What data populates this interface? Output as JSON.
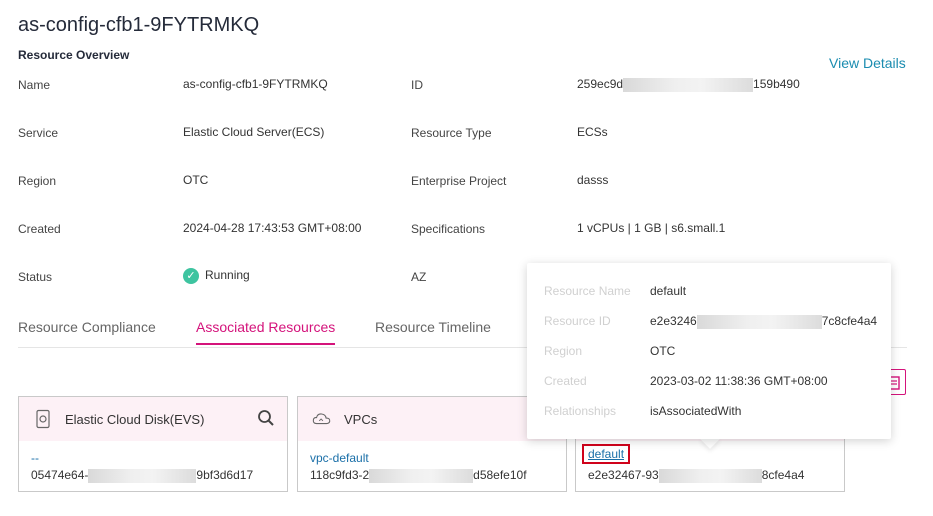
{
  "page": {
    "title": "as-config-cfb1-9FYTRMKQ",
    "section_title": "Resource Overview",
    "view_details": "View Details"
  },
  "overview": {
    "name_label": "Name",
    "name_value": "as-config-cfb1-9FYTRMKQ",
    "service_label": "Service",
    "service_value": "Elastic Cloud Server(ECS)",
    "region_label": "Region",
    "region_value": "OTC",
    "created_label": "Created",
    "created_value": "2024-04-28 17:43:53 GMT+08:00",
    "status_label": "Status",
    "status_value": "Running",
    "id_label": "ID",
    "id_prefix": "259ec9d",
    "id_suffix": "159b490",
    "type_label": "Resource Type",
    "type_value": "ECSs",
    "project_label": "Enterprise Project",
    "project_value": "dasss",
    "spec_label": "Specifications",
    "spec_value": "1 vCPUs | 1 GB | s6.small.1",
    "az_label": "AZ"
  },
  "tabs": {
    "compliance": "Resource Compliance",
    "associated": "Associated Resources",
    "timeline": "Resource Timeline"
  },
  "cards": {
    "evs": {
      "title": "Elastic Cloud Disk(EVS)",
      "link": "--",
      "id_prefix": "05474e64-",
      "id_suffix": "9bf3d6d17"
    },
    "vpc": {
      "title": "VPCs",
      "link": "vpc-default",
      "id_prefix": "118c9fd3-2",
      "id_suffix": "d58efe10f"
    },
    "sg": {
      "link": "default",
      "id_prefix": "e2e32467-93",
      "id_suffix": "8cfe4a4"
    }
  },
  "popover": {
    "name_label": "Resource Name",
    "name_value": "default",
    "id_label": "Resource ID",
    "id_prefix": "e2e3246",
    "id_suffix": "7c8cfe4a4",
    "region_label": "Region",
    "region_value": "OTC",
    "created_label": "Created",
    "created_value": "2023-03-02 11:38:36 GMT+08:00",
    "rel_label": "Relationships",
    "rel_value": "isAssociatedWith"
  },
  "icons": {
    "status": "check-circle-icon",
    "evs": "disk-icon",
    "vpc": "cloud-icon",
    "search": "search-icon",
    "filter": "filter-icon"
  },
  "colors": {
    "accent": "#d4137b",
    "link": "#1a8cb0",
    "status_ok": "#3ec4a0",
    "highlight": "#d0021b"
  }
}
